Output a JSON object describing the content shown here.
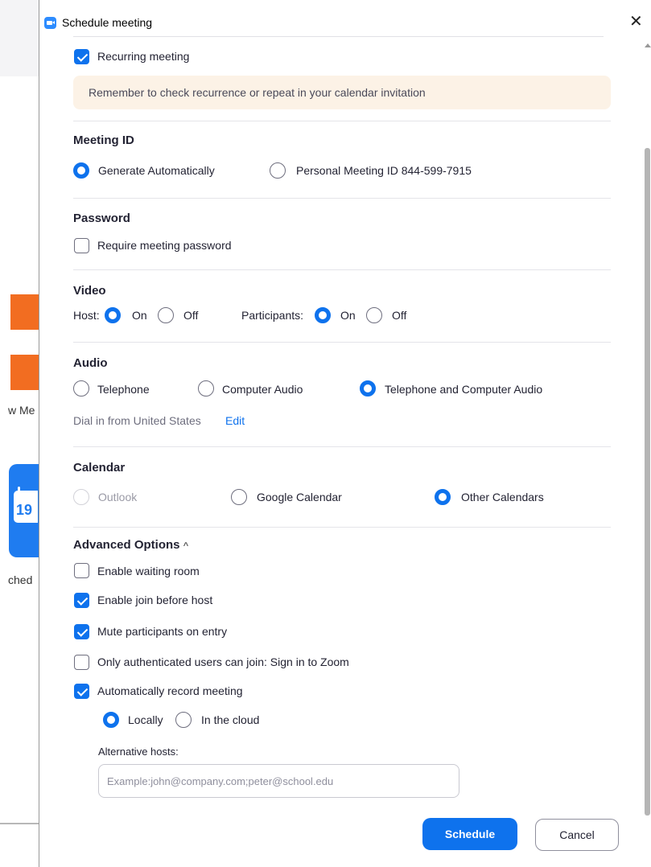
{
  "background": {
    "text_one": "w Me",
    "text_two": "ched",
    "calendar_day": "19"
  },
  "window": {
    "title": "Schedule meeting",
    "close_glyph": "✕"
  },
  "recurring": {
    "label": "Recurring meeting",
    "checked": true,
    "notice": "Remember to check recurrence or repeat in your calendar invitation"
  },
  "meeting_id": {
    "heading": "Meeting ID",
    "options": [
      {
        "label": "Generate Automatically",
        "selected": true
      },
      {
        "label": "Personal Meeting ID 844-599-7915",
        "selected": false
      }
    ]
  },
  "password": {
    "heading": "Password",
    "label": "Require meeting password",
    "checked": false
  },
  "video": {
    "heading": "Video",
    "host_label": "Host:",
    "participants_label": "Participants:",
    "on_label": "On",
    "off_label": "Off",
    "host_value": "On",
    "participants_value": "On"
  },
  "audio": {
    "heading": "Audio",
    "options": [
      {
        "label": "Telephone",
        "selected": false
      },
      {
        "label": "Computer Audio",
        "selected": false
      },
      {
        "label": "Telephone and Computer Audio",
        "selected": true
      }
    ],
    "dial_in_text": "Dial in from United States",
    "edit_link": "Edit"
  },
  "calendar": {
    "heading": "Calendar",
    "options": [
      {
        "label": "Outlook",
        "selected": false,
        "disabled": true
      },
      {
        "label": "Google Calendar",
        "selected": false
      },
      {
        "label": "Other Calendars",
        "selected": true
      }
    ]
  },
  "advanced": {
    "heading": "Advanced Options",
    "caret": "^",
    "options": [
      {
        "label": "Enable waiting room",
        "checked": false
      },
      {
        "label": "Enable join before host",
        "checked": true
      },
      {
        "label": "Mute participants on entry",
        "checked": true
      },
      {
        "label": "Only authenticated users can join: Sign in to Zoom",
        "checked": false
      },
      {
        "label": "Automatically record meeting",
        "checked": true
      }
    ],
    "record_locally": "Locally",
    "record_cloud": "In the cloud",
    "record_value": "Locally",
    "alt_hosts_label": "Alternative hosts:",
    "alt_hosts_placeholder": "Example:john@company.com;peter@school.edu",
    "alt_hosts_value": ""
  },
  "buttons": {
    "schedule": "Schedule",
    "cancel": "Cancel"
  },
  "colors": {
    "accent": "#0e72ed",
    "notice_bg": "#fcf2e6",
    "orange": "#f26d21"
  }
}
